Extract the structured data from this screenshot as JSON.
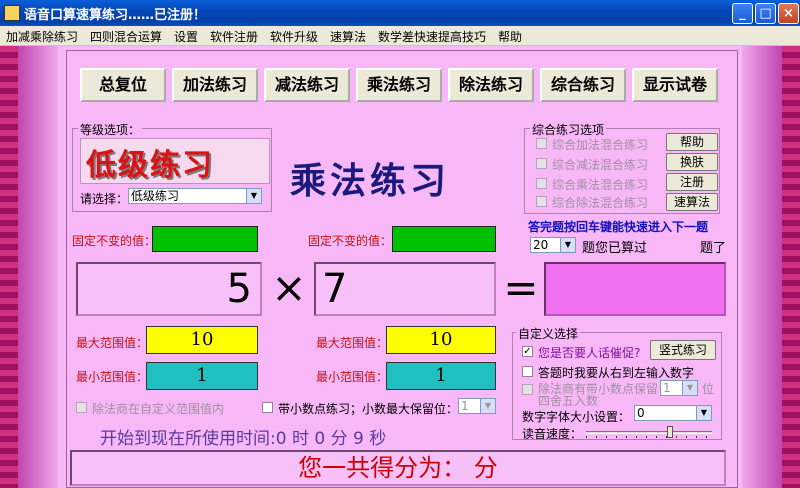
{
  "window": {
    "title": "语音口算速算练习……已注册！",
    "controls": {
      "minimize": "_",
      "maximize": "□",
      "close": "×"
    }
  },
  "menu": [
    "加减乘除练习",
    "四则混合运算",
    "设置",
    "软件注册",
    "软件升级",
    "速算法",
    "数学差快速提高技巧",
    "帮助"
  ],
  "toolbar": [
    "总复位",
    "加法练习",
    "减法练习",
    "乘法练习",
    "除法练习",
    "综合练习",
    "显示试卷"
  ],
  "level": {
    "group_label": "等级选项：",
    "display": "低级练习",
    "select_label": "请选择：",
    "select_value": "低级练习"
  },
  "mode_title": "乘法练习",
  "combo": {
    "group_label": "综合练习选项",
    "options": [
      "综合加法混合练习",
      "综合减法混合练习",
      "综合乘法混合练习",
      "综合除法混合练习"
    ],
    "buttons": [
      "帮助",
      "换肤",
      "注册",
      "速算法"
    ]
  },
  "hint": "答完题按回车键能快速进入下一题",
  "count": {
    "value": "20",
    "text1": "题您已算过",
    "text2": "题了"
  },
  "fixed_labels": [
    "固定不变的值：",
    "固定不变的值："
  ],
  "equation": {
    "left": "5",
    "op": "×",
    "right": "7",
    "eq": "=",
    "answer": ""
  },
  "range": {
    "max_label": "最大范围值：",
    "min_label": "最小范围值：",
    "max1": "10",
    "min1": "1",
    "max2": "10",
    "min2": "1"
  },
  "options_row": {
    "div_custom": "除法商在自定义范围值内",
    "decimal": "带小数点练习；小数最大保留位：",
    "decimal_value": "1"
  },
  "custom": {
    "group_label": "自定义选择",
    "urge_label": "您是否要人话催促?",
    "vertical_btn": "竖式练习",
    "rtl_label": "答题时我要从右到左输入数字",
    "div_decimal_label": "除法商有带小数点保留",
    "div_decimal_value": "1",
    "div_decimal_unit": "位",
    "rounding": "四舍五入数",
    "font_label": "数字字体大小设置：",
    "font_value": "0",
    "speed_label": "读音速度："
  },
  "timer": "开始到现在所使用时间:0 时 0 分 9 秒",
  "score": "您一共得分为：  分"
}
